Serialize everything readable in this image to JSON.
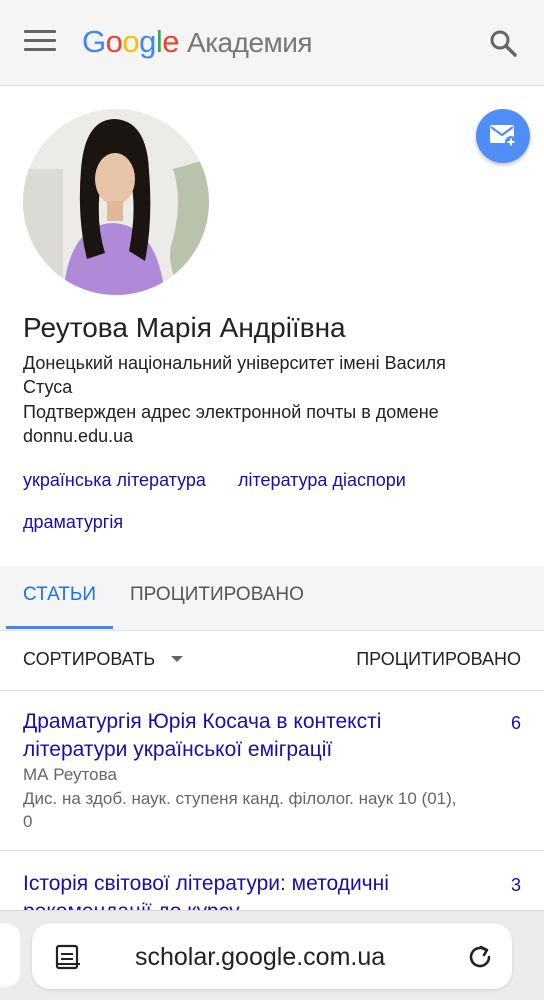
{
  "header": {
    "logo_letters": [
      "G",
      "o",
      "o",
      "g",
      "l",
      "e"
    ],
    "product": "Академия",
    "icons": {
      "menu": "hamburger-icon",
      "search": "search-icon"
    }
  },
  "profile": {
    "name": "Реутова Марія Андріївна",
    "affiliation": "Донецький національний університет імені Василя Стуса",
    "email_verified": "Подтвержден адрес электронной почты в домене donnu.edu.ua",
    "interests": [
      "українська література",
      "література діаспори",
      "драматургія"
    ],
    "avatar": "profile-photo",
    "follow_icon": "mail-add-icon"
  },
  "tabs": [
    {
      "label": "СТАТЬИ",
      "active": true
    },
    {
      "label": "ПРОЦИТИРОВАНО",
      "active": false
    }
  ],
  "sort": {
    "label": "СОРТИРОВАТЬ",
    "cited_by_header": "ПРОЦИТИРОВАНО"
  },
  "articles": [
    {
      "title": "Драматургія Юрія Косача в контексті літератури української еміграції",
      "authors": "МА Реутова",
      "publication": "Дис. на здоб. наук. ступеня канд. філолог. наук 10 (01), 0",
      "cited_by": "6"
    },
    {
      "title": "Історія світової літератури: методичні рекомендації до курсу",
      "cited_by": "3"
    }
  ],
  "browser": {
    "url": "scholar.google.com.ua",
    "icons": {
      "reader": "reader-mode-icon",
      "reload": "reload-icon"
    }
  },
  "colors": {
    "link": "#1a0dab",
    "accent": "#4285F4",
    "fab": "#4f8ef7",
    "bar_bg": "#f5f5f5"
  }
}
